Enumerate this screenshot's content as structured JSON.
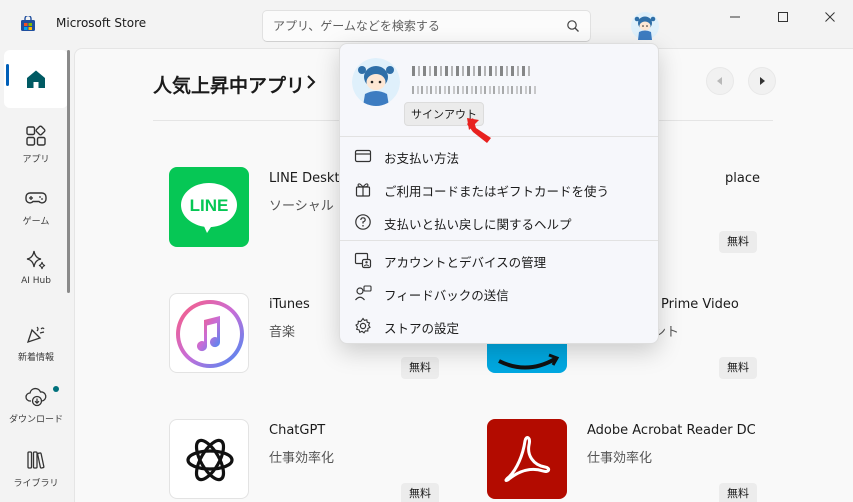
{
  "window": {
    "app_title": "Microsoft Store"
  },
  "search": {
    "placeholder": "アプリ、ゲームなどを検索する"
  },
  "nav": {
    "items": [
      {
        "label": "",
        "icon": "home-icon"
      },
      {
        "label": "アプリ",
        "icon": "apps-icon"
      },
      {
        "label": "ゲーム",
        "icon": "gamepad-icon"
      },
      {
        "label": "AI Hub",
        "icon": "sparkle-icon"
      },
      {
        "label": "新着情報",
        "icon": "party-icon"
      },
      {
        "label": "ダウンロード",
        "icon": "cloud-download-icon"
      },
      {
        "label": "ライブラリ",
        "icon": "library-icon"
      }
    ]
  },
  "main": {
    "section_title": "人気上昇中アプリ",
    "apps": [
      {
        "name": "LINE Deskto",
        "category": "ソーシャル",
        "price": ""
      },
      {
        "name": "",
        "category": "",
        "price": "無料"
      },
      {
        "name": "iTunes",
        "category": "音楽",
        "price": "無料"
      },
      {
        "name": "Prime Video",
        "category": "ント",
        "price": "無料"
      },
      {
        "name": "ChatGPT",
        "category": "仕事効率化",
        "price": "無料"
      },
      {
        "name": "Adobe Acrobat Reader DC",
        "category": "仕事効率化",
        "price": "無料"
      }
    ],
    "partial_label_marketplace": "place",
    "line_logo_text": "LINE"
  },
  "account_menu": {
    "user_name": "＊＊＊＊＊＊＊",
    "user_email": "＊＊＊＊＊＊＊＊＊＊＊＊",
    "signout_label": "サインアウト",
    "items": [
      {
        "label": "お支払い方法",
        "icon": "credit-card-icon"
      },
      {
        "label": "ご利用コードまたはギフトカードを使う",
        "icon": "gift-icon"
      },
      {
        "label": "支払いと払い戻しに関するヘルプ",
        "icon": "help-icon"
      },
      {
        "label": "アカウントとデバイスの管理",
        "icon": "account-device-icon"
      },
      {
        "label": "フィードバックの送信",
        "icon": "feedback-icon"
      },
      {
        "label": "ストアの設定",
        "icon": "settings-gear-icon"
      }
    ]
  },
  "colors": {
    "accent": "#005fb8",
    "line_green": "#06c755",
    "adobe_red": "#b30b00",
    "arrow_red": "#e8211f"
  }
}
